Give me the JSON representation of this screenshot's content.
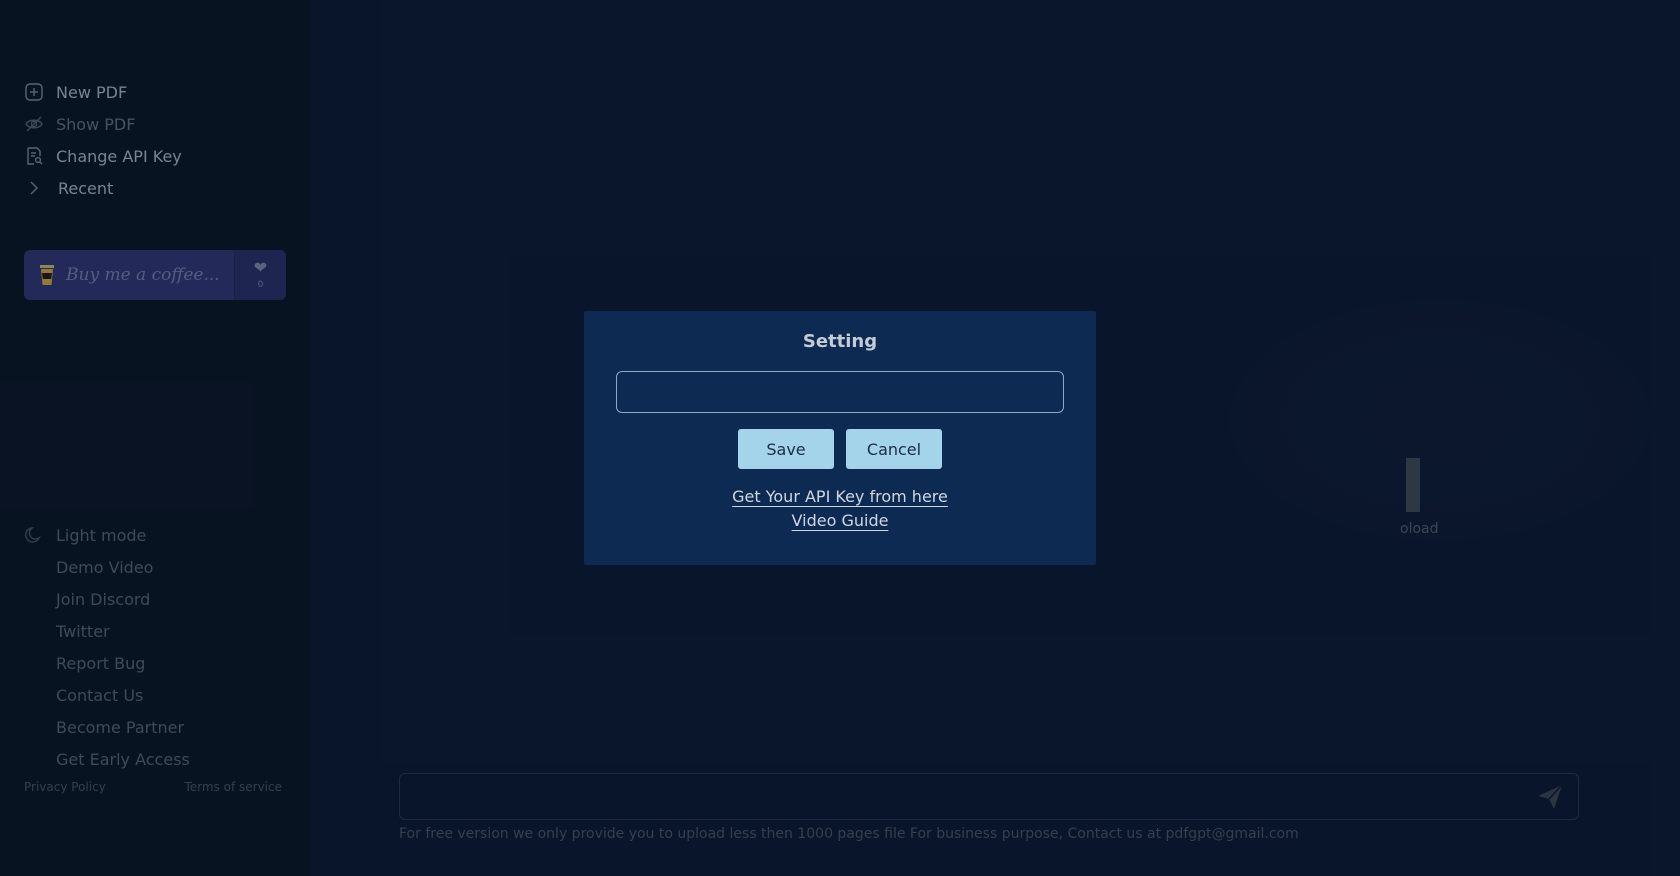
{
  "sidebar": {
    "nav": [
      {
        "label": "New PDF",
        "icon": "plus-square-icon"
      },
      {
        "label": "Show PDF",
        "icon": "eye-off-icon"
      },
      {
        "label": "Change API Key",
        "icon": "key-doc-icon"
      },
      {
        "label": "Recent",
        "icon": "chevron-right-icon"
      }
    ],
    "coffee": {
      "label": "Buy me a coffee...",
      "count": "0"
    },
    "links": [
      {
        "label": "Light mode",
        "icon": "moon-icon"
      },
      {
        "label": "Demo Video"
      },
      {
        "label": "Join Discord"
      },
      {
        "label": "Twitter"
      },
      {
        "label": "Report Bug"
      },
      {
        "label": "Contact Us"
      },
      {
        "label": "Become Partner"
      },
      {
        "label": "Get Early Access"
      }
    ],
    "footer": {
      "privacy": "Privacy Policy",
      "terms": "Terms of service"
    }
  },
  "main": {
    "ghost_text": "oload",
    "chat_placeholder": "",
    "notice": "For free version we only provide you to upload less then 1000 pages file For business purpose, Contact us at pdfgpt@gmail.com"
  },
  "modal": {
    "title": "Setting",
    "input_value": "",
    "save_label": "Save",
    "cancel_label": "Cancel",
    "api_link": "Get Your API Key from here",
    "video_link": "Video Guide"
  },
  "colors": {
    "sidebar_bg": "#0a1626",
    "main_bg": "#0c1a33",
    "modal_bg": "#0c2a52",
    "button_bg": "#a3d4ea",
    "coffee_bg": "#34397a"
  }
}
